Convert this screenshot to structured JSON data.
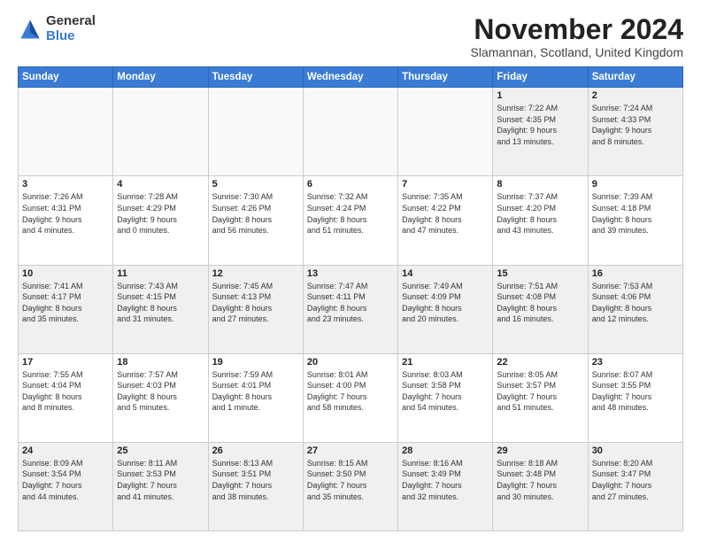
{
  "logo": {
    "general": "General",
    "blue": "Blue"
  },
  "title": "November 2024",
  "subtitle": "Slamannan, Scotland, United Kingdom",
  "days_of_week": [
    "Sunday",
    "Monday",
    "Tuesday",
    "Wednesday",
    "Thursday",
    "Friday",
    "Saturday"
  ],
  "weeks": [
    [
      {
        "day": "",
        "info": "",
        "empty": true
      },
      {
        "day": "",
        "info": "",
        "empty": true
      },
      {
        "day": "",
        "info": "",
        "empty": true
      },
      {
        "day": "",
        "info": "",
        "empty": true
      },
      {
        "day": "",
        "info": "",
        "empty": true
      },
      {
        "day": "1",
        "info": "Sunrise: 7:22 AM\nSunset: 4:35 PM\nDaylight: 9 hours\nand 13 minutes."
      },
      {
        "day": "2",
        "info": "Sunrise: 7:24 AM\nSunset: 4:33 PM\nDaylight: 9 hours\nand 8 minutes."
      }
    ],
    [
      {
        "day": "3",
        "info": "Sunrise: 7:26 AM\nSunset: 4:31 PM\nDaylight: 9 hours\nand 4 minutes."
      },
      {
        "day": "4",
        "info": "Sunrise: 7:28 AM\nSunset: 4:29 PM\nDaylight: 9 hours\nand 0 minutes."
      },
      {
        "day": "5",
        "info": "Sunrise: 7:30 AM\nSunset: 4:26 PM\nDaylight: 8 hours\nand 56 minutes."
      },
      {
        "day": "6",
        "info": "Sunrise: 7:32 AM\nSunset: 4:24 PM\nDaylight: 8 hours\nand 51 minutes."
      },
      {
        "day": "7",
        "info": "Sunrise: 7:35 AM\nSunset: 4:22 PM\nDaylight: 8 hours\nand 47 minutes."
      },
      {
        "day": "8",
        "info": "Sunrise: 7:37 AM\nSunset: 4:20 PM\nDaylight: 8 hours\nand 43 minutes."
      },
      {
        "day": "9",
        "info": "Sunrise: 7:39 AM\nSunset: 4:18 PM\nDaylight: 8 hours\nand 39 minutes."
      }
    ],
    [
      {
        "day": "10",
        "info": "Sunrise: 7:41 AM\nSunset: 4:17 PM\nDaylight: 8 hours\nand 35 minutes."
      },
      {
        "day": "11",
        "info": "Sunrise: 7:43 AM\nSunset: 4:15 PM\nDaylight: 8 hours\nand 31 minutes."
      },
      {
        "day": "12",
        "info": "Sunrise: 7:45 AM\nSunset: 4:13 PM\nDaylight: 8 hours\nand 27 minutes."
      },
      {
        "day": "13",
        "info": "Sunrise: 7:47 AM\nSunset: 4:11 PM\nDaylight: 8 hours\nand 23 minutes."
      },
      {
        "day": "14",
        "info": "Sunrise: 7:49 AM\nSunset: 4:09 PM\nDaylight: 8 hours\nand 20 minutes."
      },
      {
        "day": "15",
        "info": "Sunrise: 7:51 AM\nSunset: 4:08 PM\nDaylight: 8 hours\nand 16 minutes."
      },
      {
        "day": "16",
        "info": "Sunrise: 7:53 AM\nSunset: 4:06 PM\nDaylight: 8 hours\nand 12 minutes."
      }
    ],
    [
      {
        "day": "17",
        "info": "Sunrise: 7:55 AM\nSunset: 4:04 PM\nDaylight: 8 hours\nand 8 minutes."
      },
      {
        "day": "18",
        "info": "Sunrise: 7:57 AM\nSunset: 4:03 PM\nDaylight: 8 hours\nand 5 minutes."
      },
      {
        "day": "19",
        "info": "Sunrise: 7:59 AM\nSunset: 4:01 PM\nDaylight: 8 hours\nand 1 minute."
      },
      {
        "day": "20",
        "info": "Sunrise: 8:01 AM\nSunset: 4:00 PM\nDaylight: 7 hours\nand 58 minutes."
      },
      {
        "day": "21",
        "info": "Sunrise: 8:03 AM\nSunset: 3:58 PM\nDaylight: 7 hours\nand 54 minutes."
      },
      {
        "day": "22",
        "info": "Sunrise: 8:05 AM\nSunset: 3:57 PM\nDaylight: 7 hours\nand 51 minutes."
      },
      {
        "day": "23",
        "info": "Sunrise: 8:07 AM\nSunset: 3:55 PM\nDaylight: 7 hours\nand 48 minutes."
      }
    ],
    [
      {
        "day": "24",
        "info": "Sunrise: 8:09 AM\nSunset: 3:54 PM\nDaylight: 7 hours\nand 44 minutes."
      },
      {
        "day": "25",
        "info": "Sunrise: 8:11 AM\nSunset: 3:53 PM\nDaylight: 7 hours\nand 41 minutes."
      },
      {
        "day": "26",
        "info": "Sunrise: 8:13 AM\nSunset: 3:51 PM\nDaylight: 7 hours\nand 38 minutes."
      },
      {
        "day": "27",
        "info": "Sunrise: 8:15 AM\nSunset: 3:50 PM\nDaylight: 7 hours\nand 35 minutes."
      },
      {
        "day": "28",
        "info": "Sunrise: 8:16 AM\nSunset: 3:49 PM\nDaylight: 7 hours\nand 32 minutes."
      },
      {
        "day": "29",
        "info": "Sunrise: 8:18 AM\nSunset: 3:48 PM\nDaylight: 7 hours\nand 30 minutes."
      },
      {
        "day": "30",
        "info": "Sunrise: 8:20 AM\nSunset: 3:47 PM\nDaylight: 7 hours\nand 27 minutes."
      }
    ]
  ]
}
